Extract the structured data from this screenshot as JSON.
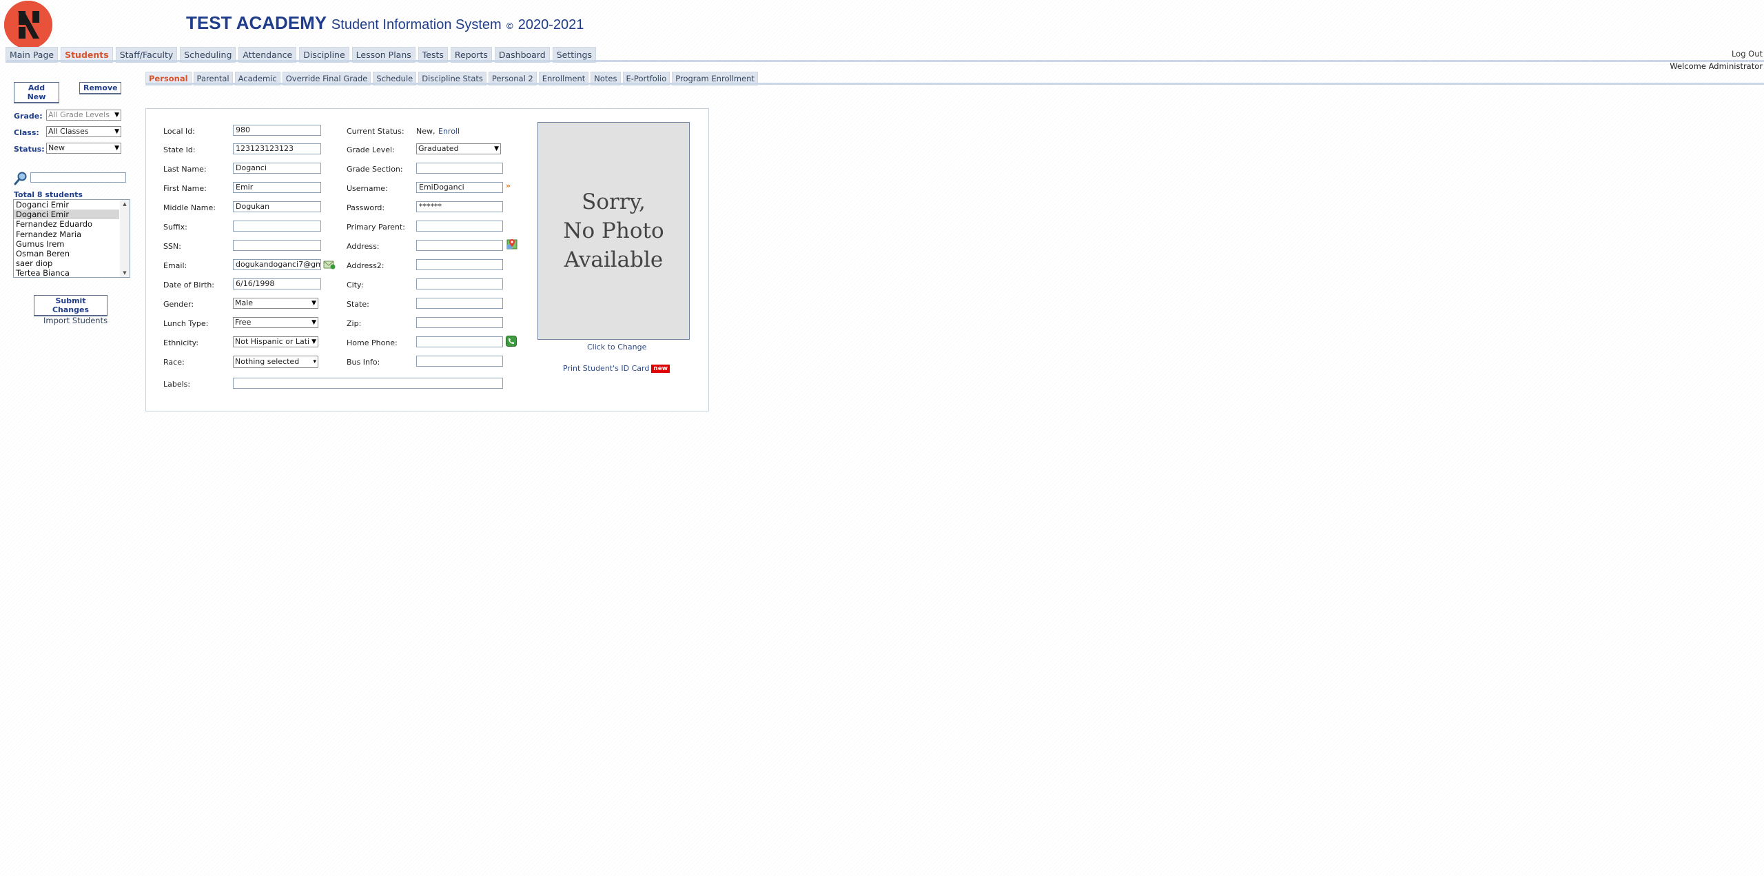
{
  "header": {
    "school": "TEST ACADEMY",
    "system": "Student Information System",
    "copyright": "©",
    "years": "2020-2021"
  },
  "topnav": [
    "Main Page",
    "Students",
    "Staff/Faculty",
    "Scheduling",
    "Attendance",
    "Discipline",
    "Lesson Plans",
    "Tests",
    "Reports",
    "Dashboard",
    "Settings"
  ],
  "topnav_active": "Students",
  "logout": "Log Out",
  "welcome": "Welcome Administrator",
  "subnav": [
    "Personal",
    "Parental",
    "Academic",
    "Override Final Grade",
    "Schedule",
    "Discipline Stats",
    "Personal 2",
    "Enrollment",
    "Notes",
    "E-Portfolio",
    "Program Enrollment"
  ],
  "subnav_active": "Personal",
  "sidebar": {
    "add_new": "Add New",
    "remove": "Remove",
    "grade_label": "Grade:",
    "grade_value": "All Grade Levels",
    "class_label": "Class:",
    "class_value": "All Classes",
    "status_label": "Status:",
    "status_value": "New",
    "total": "Total 8 students",
    "students": [
      "Doganci Emir",
      "Doganci Emir",
      "Fernandez Eduardo",
      "Fernandez Maria",
      "Gumus Irem",
      "Osman Beren",
      "saer diop",
      "Tertea Bianca"
    ],
    "selected_index": 1,
    "submit": "Submit Changes",
    "import": "Import Students"
  },
  "form": {
    "left": {
      "local_id": {
        "label": "Local Id:",
        "value": "980"
      },
      "state_id": {
        "label": "State Id:",
        "value": "123123123123"
      },
      "last_name": {
        "label": "Last Name:",
        "value": "Doganci"
      },
      "first_name": {
        "label": "First Name:",
        "value": "Emir"
      },
      "middle_name": {
        "label": "Middle Name:",
        "value": "Dogukan"
      },
      "suffix": {
        "label": "Suffix:",
        "value": ""
      },
      "ssn": {
        "label": "SSN:",
        "value": ""
      },
      "email": {
        "label": "Email:",
        "value": "dogukandoganci7@gm"
      },
      "dob": {
        "label": "Date of Birth:",
        "value": "6/16/1998"
      },
      "gender": {
        "label": "Gender:",
        "value": "Male"
      },
      "lunch": {
        "label": "Lunch Type:",
        "value": "Free"
      },
      "ethnicity": {
        "label": "Ethnicity:",
        "value": "Not Hispanic or Latino"
      },
      "race": {
        "label": "Race:",
        "value": "Nothing selected"
      },
      "labels": {
        "label": "Labels:",
        "value": ""
      }
    },
    "right": {
      "current_status": {
        "label": "Current Status:",
        "value": "New,",
        "action": "Enroll"
      },
      "grade_level": {
        "label": "Grade Level:",
        "value": "Graduated"
      },
      "grade_section": {
        "label": "Grade Section:",
        "value": ""
      },
      "username": {
        "label": "Username:",
        "value": "EmiDoganci"
      },
      "password": {
        "label": "Password:",
        "value": "******"
      },
      "primary_parent": {
        "label": "Primary Parent:",
        "value": ""
      },
      "address": {
        "label": "Address:",
        "value": ""
      },
      "address2": {
        "label": "Address2:",
        "value": ""
      },
      "city": {
        "label": "City:",
        "value": ""
      },
      "state": {
        "label": "State:",
        "value": ""
      },
      "zip": {
        "label": "Zip:",
        "value": ""
      },
      "home_phone": {
        "label": "Home Phone:",
        "value": ""
      },
      "bus_info": {
        "label": "Bus Info:",
        "value": ""
      }
    }
  },
  "photo": {
    "line1": "Sorry,",
    "line2": "No Photo",
    "line3": "Available",
    "click_to_change": "Click to Change",
    "print_id": "Print Student's ID Card",
    "badge": "new"
  }
}
